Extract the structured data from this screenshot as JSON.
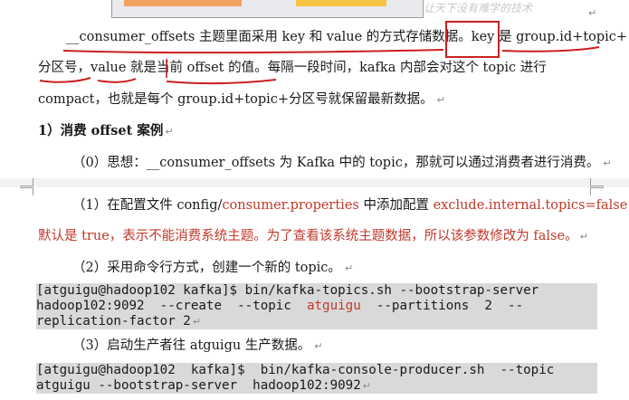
{
  "watermark": "让天下没有难学的技术",
  "para1": {
    "l1a": "__consumer_offsets 主题里面采用 key 和 value 的方式存储数据",
    "l1b": "。key 是 ",
    "l1c": "group.id+topic+",
    "l2a": "分区号",
    "l2b": "，",
    "l2c": "value",
    "l2d": " 就是当前 offset 的值。每隔一段时间，kafka 内部会对这个 topic 进行",
    "l3": "compact，也就是每个 group.id+topic+分区号就保留最新数据。"
  },
  "heading": "1）消费 offset 案例",
  "step0": "（0）思想：__consumer_offsets 为 Kafka 中的 topic，那就可以通过消费者进行消费。",
  "step1": {
    "a": "（1）在配置文件 config/",
    "b": "consumer.properties",
    "c": " 中添加配置 ",
    "d": "exclude.internal.topics=false",
    "e": "，",
    "line2": "默认是 true，表示不能消费系统主题。为了查看该系统主题数据，所以该参数修改为 false。"
  },
  "step2": "（2）采用命令行方式，创建一个新的 topic。",
  "code1": {
    "l1": "[atguigu@hadoop102 kafka]$ bin/kafka-topics.sh --bootstrap-server",
    "l2a": "hadoop102:9092  --create  --topic  ",
    "l2b": "atguigu",
    "l2c": "  --partitions  2  --",
    "l3": "replication-factor 2"
  },
  "step3": "（3）启动生产者往 atguigu 生产数据。",
  "code2": {
    "l1": "[atguigu@hadoop102  kafka]$  bin/kafka-console-producer.sh  --topic",
    "l2": "atguigu --bootstrap-server  hadoop102:9092"
  },
  "para_mark": "↵",
  "colors": {
    "red_text": "#c0392b",
    "ink": "#cc1f1f",
    "code_bg": "#d9d9d9"
  }
}
